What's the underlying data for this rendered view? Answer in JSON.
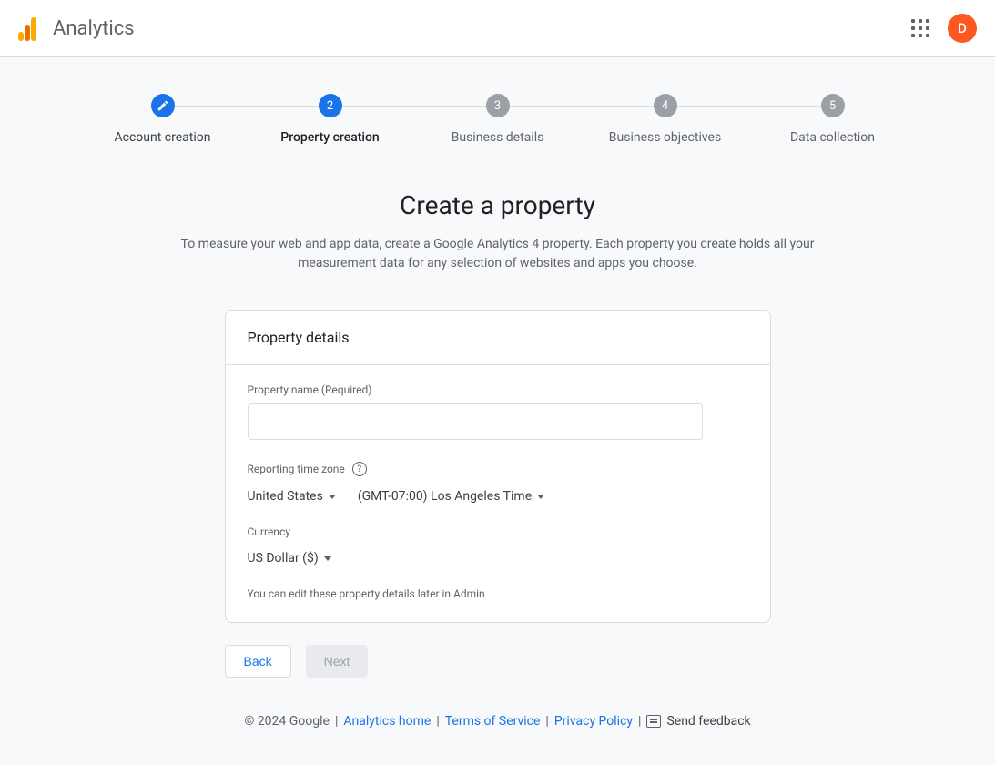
{
  "header": {
    "app_title": "Analytics",
    "avatar_initial": "D"
  },
  "stepper": {
    "steps": [
      {
        "label": "Account creation",
        "state": "done"
      },
      {
        "label": "Property creation",
        "state": "active",
        "number": "2"
      },
      {
        "label": "Business details",
        "state": "pending",
        "number": "3"
      },
      {
        "label": "Business objectives",
        "state": "pending",
        "number": "4"
      },
      {
        "label": "Data collection",
        "state": "pending",
        "number": "5"
      }
    ]
  },
  "content": {
    "title": "Create a property",
    "subtitle": "To measure your web and app data, create a Google Analytics 4 property. Each property you create holds all your measurement data for any selection of websites and apps you choose."
  },
  "card": {
    "header": "Property details",
    "property_name_label": "Property name (Required)",
    "property_name_value": "",
    "timezone_label": "Reporting time zone",
    "country_value": "United States",
    "timezone_value": "(GMT-07:00) Los Angeles Time",
    "currency_label": "Currency",
    "currency_value": "US Dollar ($)",
    "hint": "You can edit these property details later in Admin"
  },
  "buttons": {
    "back": "Back",
    "next": "Next"
  },
  "footer": {
    "copyright": "© 2024 Google",
    "links": {
      "analytics_home": "Analytics home",
      "terms": "Terms of Service",
      "privacy": "Privacy Policy"
    },
    "feedback": "Send feedback"
  }
}
